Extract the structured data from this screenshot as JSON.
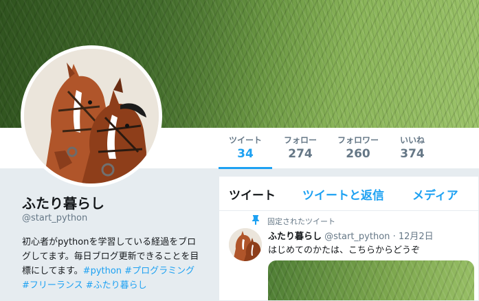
{
  "profile": {
    "name": "ふたり暮らし",
    "handle": "@start_python",
    "bio": "初心者がpythonを学習している経過をブログしてます。毎日ブログ更新できることを目標にしてます。",
    "bio_tags": "#python #プログラミング #フリーランス #ふたり暮らし"
  },
  "stats": [
    {
      "label": "ツイート",
      "value": "34"
    },
    {
      "label": "フォロー",
      "value": "274"
    },
    {
      "label": "フォロワー",
      "value": "260"
    },
    {
      "label": "いいね",
      "value": "374"
    }
  ],
  "tabs": [
    "ツイート",
    "ツイートと返信",
    "メディア"
  ],
  "tweet": {
    "pinned_label": "固定されたツイート",
    "name": "ふたり暮らし",
    "handle": "@start_python",
    "dot": "·",
    "date": "12月2日",
    "text": "はじめてのかたは、こちらからどうぞ"
  },
  "colors": {
    "accent": "#1da1f2",
    "muted": "#657786",
    "background": "#e6ecf0"
  },
  "icons": {
    "pin": "pin-icon"
  }
}
